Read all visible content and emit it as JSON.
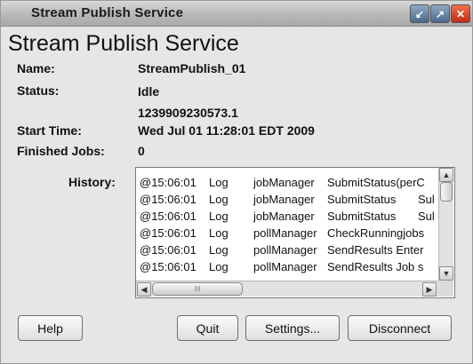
{
  "window": {
    "title": "Stream Publish Service"
  },
  "heading": "Stream Publish Service",
  "fields": {
    "name_label": "Name:",
    "name_value": "StreamPublish_01",
    "status_label": "Status:",
    "status_value": "Idle",
    "start_id": "1239909230573.1",
    "start_label": "Start Time:",
    "start_value": "Wed Jul 01 11:28:01 EDT 2009",
    "jobs_label": "Finished Jobs:",
    "jobs_value": "0"
  },
  "history": {
    "label": "History:",
    "rows": [
      [
        "@15:06:01",
        "Log",
        "jobManager",
        "SubmitStatus(perC",
        ""
      ],
      [
        "@15:06:01",
        "Log",
        "jobManager",
        "SubmitStatus",
        "Sul"
      ],
      [
        "@15:06:01",
        "Log",
        "jobManager",
        "SubmitStatus",
        "Sul"
      ],
      [
        "@15:06:01",
        "Log",
        "pollManager",
        "CheckRunningjobs",
        ""
      ],
      [
        "@15:06:01",
        "Log",
        "pollManager",
        "SendResults Enter",
        ""
      ],
      [
        "@15:06:01",
        "Log",
        "pollManager",
        "SendResults Job s",
        ""
      ]
    ],
    "hthumb_grip": "III"
  },
  "buttons": {
    "help": "Help",
    "quit": "Quit",
    "settings": "Settings...",
    "disconnect": "Disconnect"
  },
  "colors": {
    "close": "#c02a10",
    "titlebar": "#b8b8b8"
  }
}
